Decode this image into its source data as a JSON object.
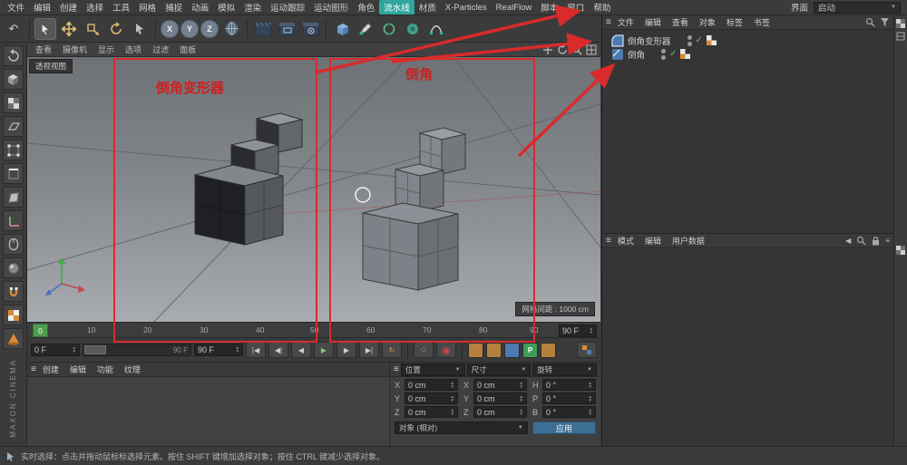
{
  "glyphs": {
    "hamburger": "≡",
    "down": "▼",
    "undo": "↶",
    "loop": "↻",
    "left": "◀",
    "right": "▶",
    "plus": "+",
    "rotate": "↻",
    "record": "◉",
    "circle": "○",
    "check": "✓",
    "updown": "⇅"
  },
  "menubar": {
    "items": [
      "文件",
      "编辑",
      "创建",
      "选择",
      "工具",
      "网格",
      "捕捉",
      "动画",
      "模拟",
      "渲染",
      "运动跟踪",
      "运动图形",
      "角色",
      "流水线",
      "材质",
      "X-Particles",
      "RealFlow",
      "脚本",
      "窗口",
      "帮助"
    ],
    "interface_label": "界面",
    "layout_value": "启动"
  },
  "toolbar": {
    "axis_x": "X",
    "axis_y": "Y",
    "axis_z": "Z"
  },
  "viewport": {
    "menu": [
      "查看",
      "摄像机",
      "显示",
      "选项",
      "过滤",
      "面板"
    ],
    "view_label": "透视视图",
    "grid_label": "网格间距 : 1000 cm"
  },
  "annotations": {
    "label_left": "倒角变形器",
    "label_right": "倒角"
  },
  "timeline": {
    "ticks": [
      "0",
      "10",
      "20",
      "30",
      "40",
      "50",
      "60",
      "70",
      "80",
      "90"
    ],
    "end_field": "90 F"
  },
  "animbar": {
    "current_frame": "0 F",
    "range_end": "90 F",
    "end_frame": "90 F",
    "p_label": "P",
    "transport": [
      "|◀",
      "◀|",
      "◀",
      "▶",
      "▶",
      "▶|",
      "↻"
    ]
  },
  "materials": {
    "menu": [
      "创建",
      "编辑",
      "功能",
      "纹理"
    ]
  },
  "coords": {
    "headers": [
      "位置",
      "尺寸",
      "旋转"
    ],
    "labels": [
      [
        "X",
        "Y",
        "Z"
      ],
      [
        "X",
        "Y",
        "Z"
      ],
      [
        "H",
        "P",
        "B"
      ]
    ],
    "values": [
      [
        "0 cm",
        "0 cm",
        "0 cm"
      ],
      [
        "0 cm",
        "0 cm",
        "0 cm"
      ],
      [
        "0 °",
        "0 °",
        "0 °"
      ]
    ],
    "mode_dropdown": "对象 (相对)",
    "apply_button": "应用"
  },
  "object_manager": {
    "menu": [
      "文件",
      "编辑",
      "查看",
      "对象",
      "标签",
      "书签"
    ],
    "objects": [
      "倒角变形器",
      "倒角"
    ]
  },
  "attribute_manager": {
    "menu": [
      "模式",
      "编辑",
      "用户数据"
    ]
  },
  "branding": {
    "vertical_logo": "MAXON CINEMA"
  },
  "statusbar": {
    "text": "实时选择：点击并拖动鼠标标选择元素。按住 SHIFT 键增加选择对象；按住 CTRL 键减少选择对象。"
  },
  "colors": {
    "accent_red": "#d92b2b",
    "highlight_teal": "#2fa79e",
    "play_green": "#58b058"
  }
}
